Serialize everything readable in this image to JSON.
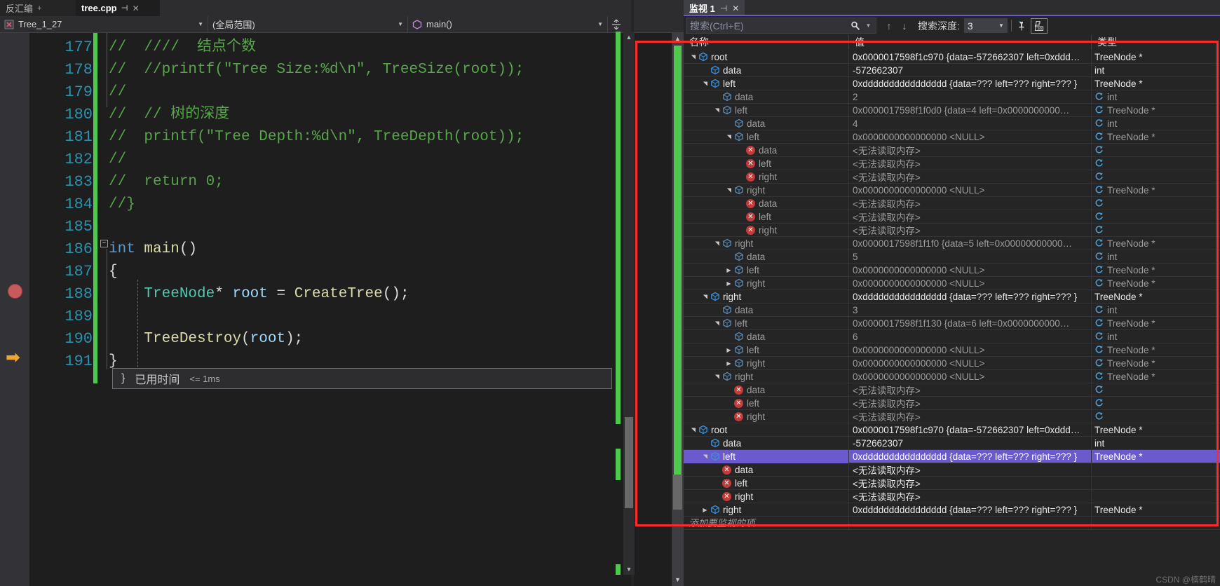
{
  "editor": {
    "tabs": [
      {
        "label": "反汇编",
        "state": "inactive",
        "pin": "+",
        "close": ""
      },
      {
        "label": "tree.cpp",
        "state": "active",
        "pin": "⊣",
        "close": "✕"
      }
    ],
    "nav": {
      "project": "Tree_1_27",
      "scope": "(全局范围)",
      "member": "main()",
      "project_icon": "project-icon",
      "member_icon": "method-cube-icon",
      "splitter_icon": "split-window-icon"
    },
    "first_line": 177,
    "lines": [
      {
        "n": 177,
        "text": "//  ////  结点个数",
        "kind": "comment",
        "changed": true
      },
      {
        "n": 178,
        "text": "//  //printf(\"Tree Size:%d\\n\", TreeSize(root));",
        "kind": "comment",
        "changed": true
      },
      {
        "n": 179,
        "text": "//",
        "kind": "comment",
        "changed": true
      },
      {
        "n": 180,
        "text": "//  // 树的深度",
        "kind": "comment",
        "changed": true
      },
      {
        "n": 181,
        "text": "//  printf(\"Tree Depth:%d\\n\", TreeDepth(root));",
        "kind": "comment",
        "changed": true
      },
      {
        "n": 182,
        "text": "//",
        "kind": "comment",
        "changed": true
      },
      {
        "n": 183,
        "text": "//  return 0;",
        "kind": "comment",
        "changed": true
      },
      {
        "n": 184,
        "text": "//}",
        "kind": "comment",
        "changed": true
      },
      {
        "n": 185,
        "text": "",
        "kind": "blank",
        "changed": true
      },
      {
        "n": 186,
        "text": "int main()",
        "kind": "code",
        "changed": true
      },
      {
        "n": 187,
        "text": "{",
        "kind": "code",
        "changed": true
      },
      {
        "n": 188,
        "text": "    TreeNode* root = CreateTree();",
        "kind": "code",
        "changed": true,
        "breakpoint": true
      },
      {
        "n": 189,
        "text": "",
        "kind": "blank",
        "changed": true
      },
      {
        "n": 190,
        "text": "    TreeDestroy(root);",
        "kind": "code",
        "changed": true
      },
      {
        "n": 191,
        "text": "}",
        "kind": "code",
        "changed": true,
        "current": true
      }
    ],
    "elapsed": {
      "brace": "}",
      "label": "已用时间",
      "value": "<= 1ms"
    }
  },
  "watch": {
    "tab": {
      "label": "监视 1",
      "pin": "⊣",
      "close": "✕"
    },
    "toolbar": {
      "search_placeholder": "搜索(Ctrl+E)",
      "search_value": "",
      "search_icon": "search-icon",
      "search_dropdown_icon": "chevron-down-icon",
      "prev_icon": "arrow-up-icon",
      "next_icon": "arrow-down-icon",
      "depth_label": "搜索深度:",
      "depth_value": "3",
      "pin_icon": "pin-icon",
      "hex_icon": "hex-display-icon"
    },
    "columns": [
      "名称",
      "值",
      "类型"
    ],
    "add_watch_placeholder": "添加要监视的项",
    "rows": [
      {
        "indent": 0,
        "exp": "expanded",
        "icon": "cube",
        "name": "root",
        "value": "0x0000017598f1c970 {data=-572662307 left=0xddd…",
        "type": "TreeNode *",
        "tone": "white",
        "refresh": false
      },
      {
        "indent": 1,
        "exp": "none",
        "icon": "cube",
        "name": "data",
        "value": "-572662307",
        "type": "int",
        "tone": "white",
        "refresh": false
      },
      {
        "indent": 1,
        "exp": "expanded",
        "icon": "cube",
        "name": "left",
        "value": "0xdddddddddddddddd {data=??? left=??? right=??? }",
        "type": "TreeNode *",
        "tone": "white",
        "refresh": false
      },
      {
        "indent": 2,
        "exp": "none",
        "icon": "cube",
        "name": "data",
        "value": "2",
        "type": "int",
        "tone": "gray",
        "refresh": true
      },
      {
        "indent": 2,
        "exp": "expanded",
        "icon": "cube",
        "name": "left",
        "value": "0x0000017598f1f0d0 {data=4 left=0x0000000000…",
        "type": "TreeNode *",
        "tone": "gray",
        "refresh": true
      },
      {
        "indent": 3,
        "exp": "none",
        "icon": "cube",
        "name": "data",
        "value": "4",
        "type": "int",
        "tone": "gray",
        "refresh": true
      },
      {
        "indent": 3,
        "exp": "expanded",
        "icon": "cube",
        "name": "left",
        "value": "0x0000000000000000 <NULL>",
        "type": "TreeNode *",
        "tone": "gray",
        "refresh": true
      },
      {
        "indent": 4,
        "exp": "none",
        "icon": "error",
        "name": "data",
        "value": "<无法读取内存>",
        "type": "",
        "tone": "gray",
        "refresh": true
      },
      {
        "indent": 4,
        "exp": "none",
        "icon": "error",
        "name": "left",
        "value": "<无法读取内存>",
        "type": "",
        "tone": "gray",
        "refresh": true
      },
      {
        "indent": 4,
        "exp": "none",
        "icon": "error",
        "name": "right",
        "value": "<无法读取内存>",
        "type": "",
        "tone": "gray",
        "refresh": true
      },
      {
        "indent": 3,
        "exp": "expanded",
        "icon": "cube",
        "name": "right",
        "value": "0x0000000000000000 <NULL>",
        "type": "TreeNode *",
        "tone": "gray",
        "refresh": true
      },
      {
        "indent": 4,
        "exp": "none",
        "icon": "error",
        "name": "data",
        "value": "<无法读取内存>",
        "type": "",
        "tone": "gray",
        "refresh": true
      },
      {
        "indent": 4,
        "exp": "none",
        "icon": "error",
        "name": "left",
        "value": "<无法读取内存>",
        "type": "",
        "tone": "gray",
        "refresh": true
      },
      {
        "indent": 4,
        "exp": "none",
        "icon": "error",
        "name": "right",
        "value": "<无法读取内存>",
        "type": "",
        "tone": "gray",
        "refresh": true
      },
      {
        "indent": 2,
        "exp": "expanded",
        "icon": "cube",
        "name": "right",
        "value": "0x0000017598f1f1f0 {data=5 left=0x00000000000…",
        "type": "TreeNode *",
        "tone": "gray",
        "refresh": true
      },
      {
        "indent": 3,
        "exp": "none",
        "icon": "cube",
        "name": "data",
        "value": "5",
        "type": "int",
        "tone": "gray",
        "refresh": true
      },
      {
        "indent": 3,
        "exp": "collapsed",
        "icon": "cube",
        "name": "left",
        "value": "0x0000000000000000 <NULL>",
        "type": "TreeNode *",
        "tone": "gray",
        "refresh": true
      },
      {
        "indent": 3,
        "exp": "collapsed",
        "icon": "cube",
        "name": "right",
        "value": "0x0000000000000000 <NULL>",
        "type": "TreeNode *",
        "tone": "gray",
        "refresh": true
      },
      {
        "indent": 1,
        "exp": "expanded",
        "icon": "cube",
        "name": "right",
        "value": "0xdddddddddddddddd {data=??? left=??? right=??? }",
        "type": "TreeNode *",
        "tone": "white",
        "refresh": false
      },
      {
        "indent": 2,
        "exp": "none",
        "icon": "cube",
        "name": "data",
        "value": "3",
        "type": "int",
        "tone": "gray",
        "refresh": true
      },
      {
        "indent": 2,
        "exp": "expanded",
        "icon": "cube",
        "name": "left",
        "value": "0x0000017598f1f130 {data=6 left=0x0000000000…",
        "type": "TreeNode *",
        "tone": "gray",
        "refresh": true
      },
      {
        "indent": 3,
        "exp": "none",
        "icon": "cube",
        "name": "data",
        "value": "6",
        "type": "int",
        "tone": "gray",
        "refresh": true
      },
      {
        "indent": 3,
        "exp": "collapsed",
        "icon": "cube",
        "name": "left",
        "value": "0x0000000000000000 <NULL>",
        "type": "TreeNode *",
        "tone": "gray",
        "refresh": true
      },
      {
        "indent": 3,
        "exp": "collapsed",
        "icon": "cube",
        "name": "right",
        "value": "0x0000000000000000 <NULL>",
        "type": "TreeNode *",
        "tone": "gray",
        "refresh": true
      },
      {
        "indent": 2,
        "exp": "expanded",
        "icon": "cube",
        "name": "right",
        "value": "0x0000000000000000 <NULL>",
        "type": "TreeNode *",
        "tone": "gray",
        "refresh": true
      },
      {
        "indent": 3,
        "exp": "none",
        "icon": "error",
        "name": "data",
        "value": "<无法读取内存>",
        "type": "",
        "tone": "gray",
        "refresh": true
      },
      {
        "indent": 3,
        "exp": "none",
        "icon": "error",
        "name": "left",
        "value": "<无法读取内存>",
        "type": "",
        "tone": "gray",
        "refresh": true
      },
      {
        "indent": 3,
        "exp": "none",
        "icon": "error",
        "name": "right",
        "value": "<无法读取内存>",
        "type": "",
        "tone": "gray",
        "refresh": true
      },
      {
        "indent": 0,
        "exp": "expanded",
        "icon": "cube",
        "name": "root",
        "value": "0x0000017598f1c970 {data=-572662307 left=0xddd…",
        "type": "TreeNode *",
        "tone": "white",
        "refresh": false
      },
      {
        "indent": 1,
        "exp": "none",
        "icon": "cube",
        "name": "data",
        "value": "-572662307",
        "type": "int",
        "tone": "white",
        "refresh": false
      },
      {
        "indent": 1,
        "exp": "expanded",
        "icon": "cube",
        "name": "left",
        "value": "0xdddddddddddddddd {data=??? left=??? right=??? }",
        "type": "TreeNode *",
        "tone": "white",
        "refresh": false,
        "selected": true
      },
      {
        "indent": 2,
        "exp": "none",
        "icon": "error",
        "name": "data",
        "value": "<无法读取内存>",
        "type": "",
        "tone": "white",
        "refresh": false
      },
      {
        "indent": 2,
        "exp": "none",
        "icon": "error",
        "name": "left",
        "value": "<无法读取内存>",
        "type": "",
        "tone": "white",
        "refresh": false
      },
      {
        "indent": 2,
        "exp": "none",
        "icon": "error",
        "name": "right",
        "value": "<无法读取内存>",
        "type": "",
        "tone": "white",
        "refresh": false
      },
      {
        "indent": 1,
        "exp": "collapsed",
        "icon": "cube",
        "name": "right",
        "value": "0xdddddddddddddddd {data=??? left=??? right=??? }",
        "type": "TreeNode *",
        "tone": "white",
        "refresh": false
      }
    ]
  },
  "watermark": "CSDN @楠鹤晴",
  "colors": {
    "accent": "#6a5acd",
    "annotation": "#ff2a2a",
    "changebar": "#4ec94e",
    "comment": "#57a64a",
    "linenumber": "#2b91af",
    "breakpoint": "#c75a5a",
    "current_arrow": "#f0a532"
  }
}
